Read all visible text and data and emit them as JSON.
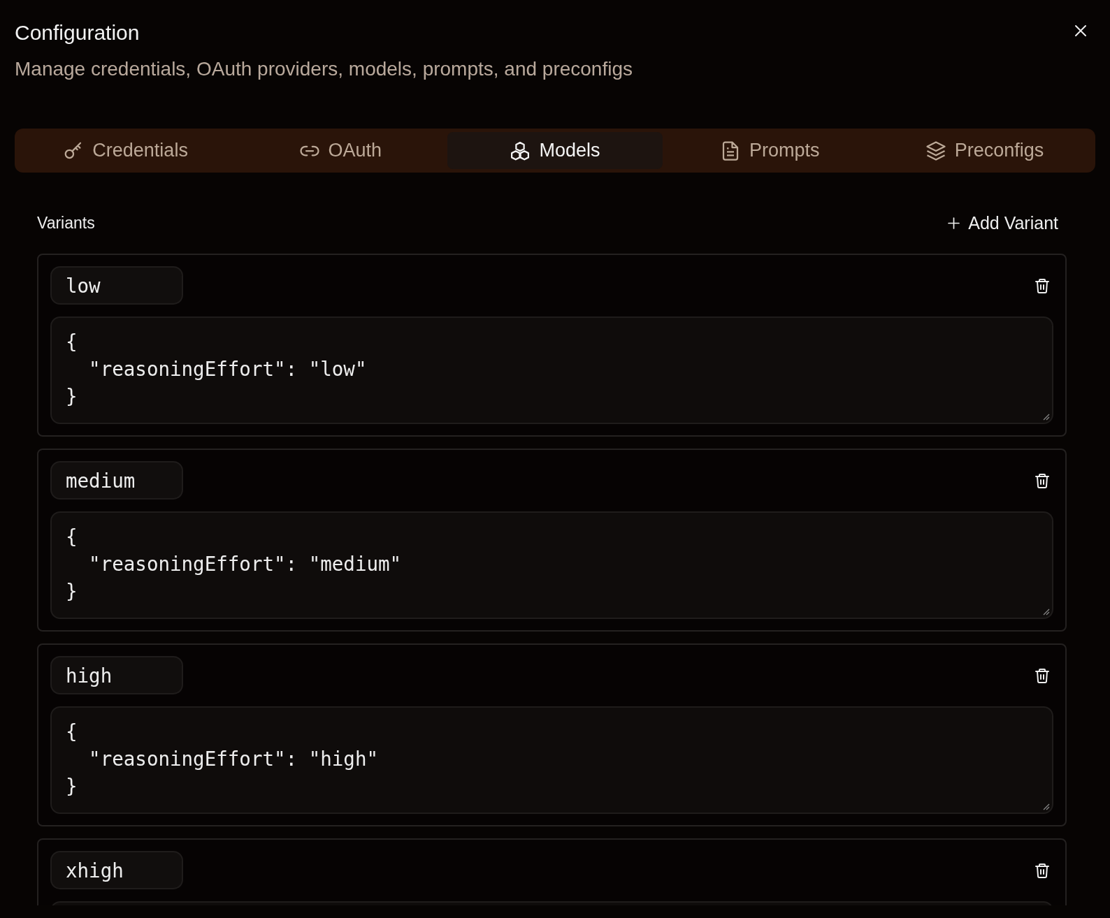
{
  "dialog": {
    "title": "Configuration",
    "subtitle": "Manage credentials, OAuth providers, models, prompts, and preconfigs"
  },
  "tabs": [
    {
      "label": "Credentials",
      "kind": "key",
      "selected": false
    },
    {
      "label": "OAuth",
      "kind": "link",
      "selected": false
    },
    {
      "label": "Models",
      "kind": "boxes",
      "selected": true
    },
    {
      "label": "Prompts",
      "kind": "file",
      "selected": false
    },
    {
      "label": "Preconfigs",
      "kind": "layers",
      "selected": false
    }
  ],
  "variants_section": {
    "heading": "Variants",
    "add_button": "Add Variant"
  },
  "variants": [
    {
      "name": "low",
      "config": "{\n  \"reasoningEffort\": \"low\"\n}"
    },
    {
      "name": "medium",
      "config": "{\n  \"reasoningEffort\": \"medium\"\n}"
    },
    {
      "name": "high",
      "config": "{\n  \"reasoningEffort\": \"high\"\n}"
    },
    {
      "name": "xhigh"
    }
  ]
}
